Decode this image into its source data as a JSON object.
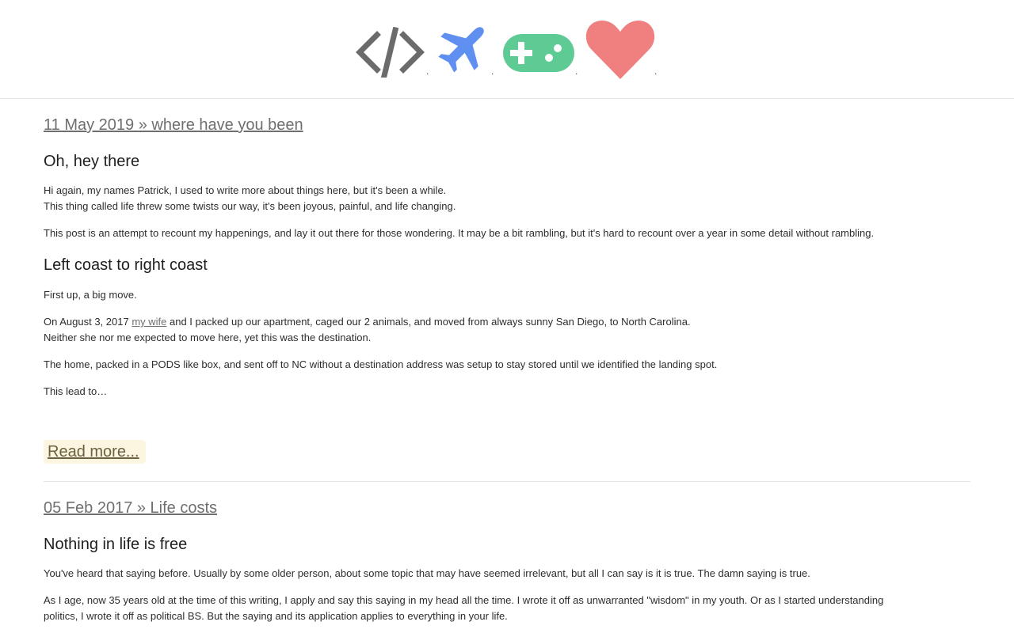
{
  "header": {
    "icons": [
      {
        "name": "code-icon",
        "color": "#6b6b6b"
      },
      {
        "name": "airplane-icon",
        "color": "#5f8ff0"
      },
      {
        "name": "gamepad-icon",
        "color": "#5fcb94"
      },
      {
        "name": "heart-icon",
        "color": "#f07f7f"
      }
    ],
    "separator": "."
  },
  "posts": [
    {
      "link": "11 May 2019 » where have you been",
      "sections": {
        "h1": "Oh, hey there",
        "p1_line1": "Hi again, my names Patrick, I used to write more about things here, but it's been a while.",
        "p1_line2": "This thing called life threw some twists our way, it's been joyous, painful, and life changing.",
        "p2": "This post is an attempt to recount my happenings, and lay it out there for those wondering. It may be a bit rambling, but it's hard to recount over a year in some detail without rambling.",
        "h2": "Left coast to right coast",
        "p3": "First up, a big move.",
        "p4_before_link": "On August 3, 2017 ",
        "p4_link": "my wife",
        "p4_after_link": " and I packed up our apartment, caged our 2 animals, and moved from always sunny San Diego, to North Carolina.",
        "p4_line2": "Neither she nor me expected to move here, yet this was the destination.",
        "p5": "The home, packed in a PODS like box, and sent off to NC without a destination address was setup to stay stored until we identified the landing spot.",
        "p6": "This lead to…"
      },
      "read_more": "Read more..."
    },
    {
      "link": "05 Feb 2017 » Life costs",
      "sections": {
        "h1": "Nothing in life is free",
        "p1": "You've heard that saying before. Usually by some older person, about some topic that may have seemed irrelevant, but all I can say is it is true. The damn saying is true.",
        "p2_line1": "As I age, now 35 years old at the time of this writing, I apply and say this saying in my head all the time. I wrote it off as unwarranted \"wisdom\" in my youth. Or as I started understanding",
        "p2_line2": "politics, I wrote it off as political BS. But the saying and its application applies to everything in your life."
      }
    }
  ]
}
